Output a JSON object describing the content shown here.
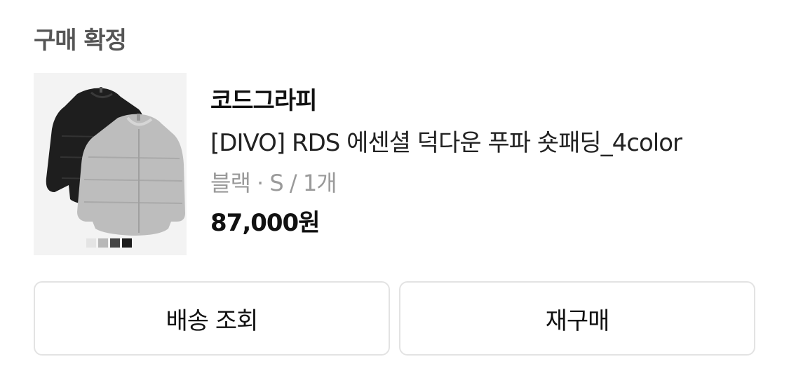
{
  "order": {
    "status": "구매 확정"
  },
  "product": {
    "brand": "코드그라피",
    "title": "[DIVO] RDS 에센셜 덕다운 푸파 숏패딩_4color",
    "option": "블랙 · S / 1개",
    "price": "87,000원",
    "swatches": [
      "#e4e4e4",
      "#b8b8b8",
      "#444444",
      "#1c1c1c"
    ]
  },
  "actions": {
    "track_delivery": "배송 조회",
    "reorder": "재구매"
  }
}
